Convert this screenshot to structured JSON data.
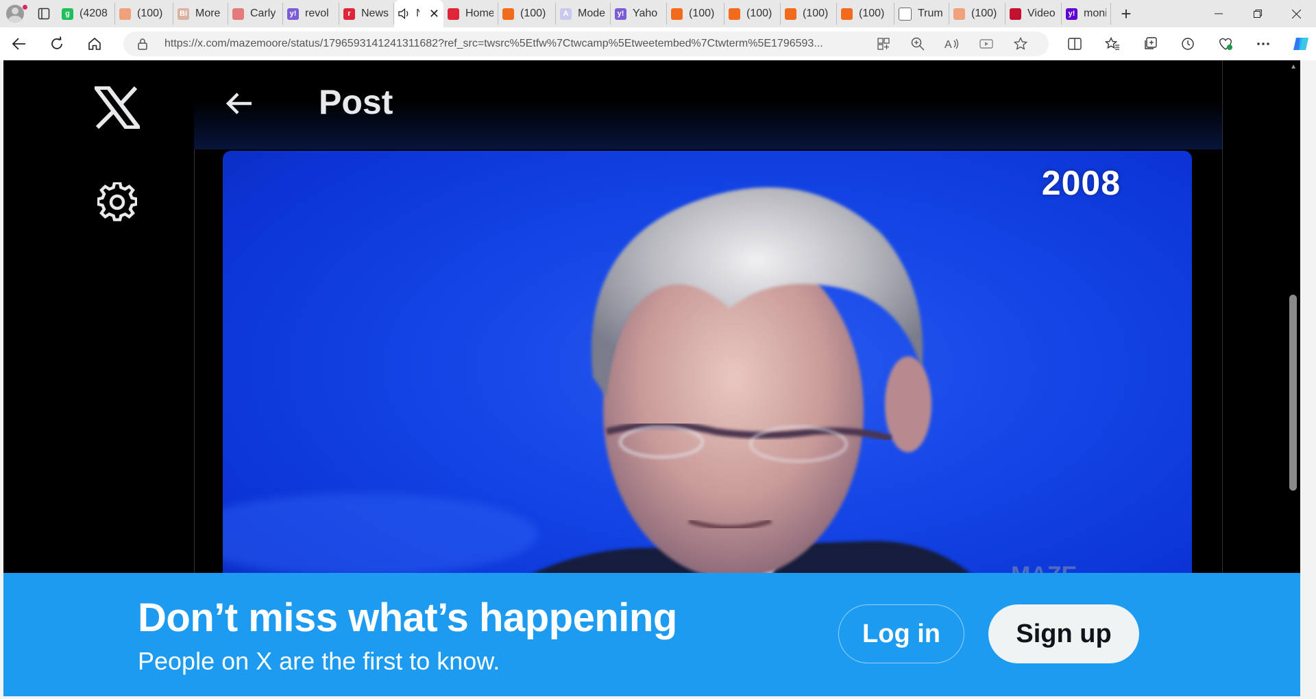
{
  "browser": {
    "tabs": [
      {
        "title": "(4208",
        "favicon_color": "#1fbf5a",
        "glyph": "g"
      },
      {
        "title": "(100)",
        "favicon_color": "#f0a07a",
        "glyph": ""
      },
      {
        "title": "More",
        "favicon_color": "#d9b2a0",
        "glyph": "BI"
      },
      {
        "title": "Carly",
        "favicon_color": "#e47a7a",
        "glyph": ""
      },
      {
        "title": "revol",
        "favicon_color": "#7b5cd6",
        "glyph": "y!"
      },
      {
        "title": "News",
        "favicon_color": "#e0243a",
        "glyph": "r"
      },
      {
        "title": "N",
        "favicon_color": "#ffffff",
        "glyph": "",
        "active": true
      },
      {
        "title": "Home",
        "favicon_color": "#e0243a",
        "glyph": ""
      },
      {
        "title": "(100)",
        "favicon_color": "#f26a1b",
        "glyph": ""
      },
      {
        "title": "Mode",
        "favicon_color": "#c9c9ef",
        "glyph": "A"
      },
      {
        "title": "Yaho",
        "favicon_color": "#7b5cd6",
        "glyph": "y!"
      },
      {
        "title": "(100)",
        "favicon_color": "#f26a1b",
        "glyph": ""
      },
      {
        "title": "(100)",
        "favicon_color": "#f26a1b",
        "glyph": ""
      },
      {
        "title": "(100)",
        "favicon_color": "#f26a1b",
        "glyph": ""
      },
      {
        "title": "(100)",
        "favicon_color": "#f26a1b",
        "glyph": ""
      },
      {
        "title": "Trum",
        "favicon_color": "#ffffff",
        "glyph": ""
      },
      {
        "title": "(100)",
        "favicon_color": "#f0a07a",
        "glyph": ""
      },
      {
        "title": "Video",
        "favicon_color": "#c3112f",
        "glyph": ""
      },
      {
        "title": "moni",
        "favicon_color": "#5f01d1",
        "glyph": "y!"
      }
    ],
    "url": "https://x.com/mazemoore/status/1796593141241311682?ref_src=twsrc%5Etfw%7Ctwcamp%5Etweetembed%7Ctwterm%5E1796593..."
  },
  "page": {
    "header_title": "Post",
    "video_overlay_year": "2008"
  },
  "banner": {
    "heading": "Don’t miss what’s happening",
    "subheading": "People on X are the first to know.",
    "login_label": "Log in",
    "signup_label": "Sign up"
  },
  "colors": {
    "x_blue": "#1d9bf0",
    "page_bg": "#000000",
    "video_blue": "#1446e6"
  }
}
